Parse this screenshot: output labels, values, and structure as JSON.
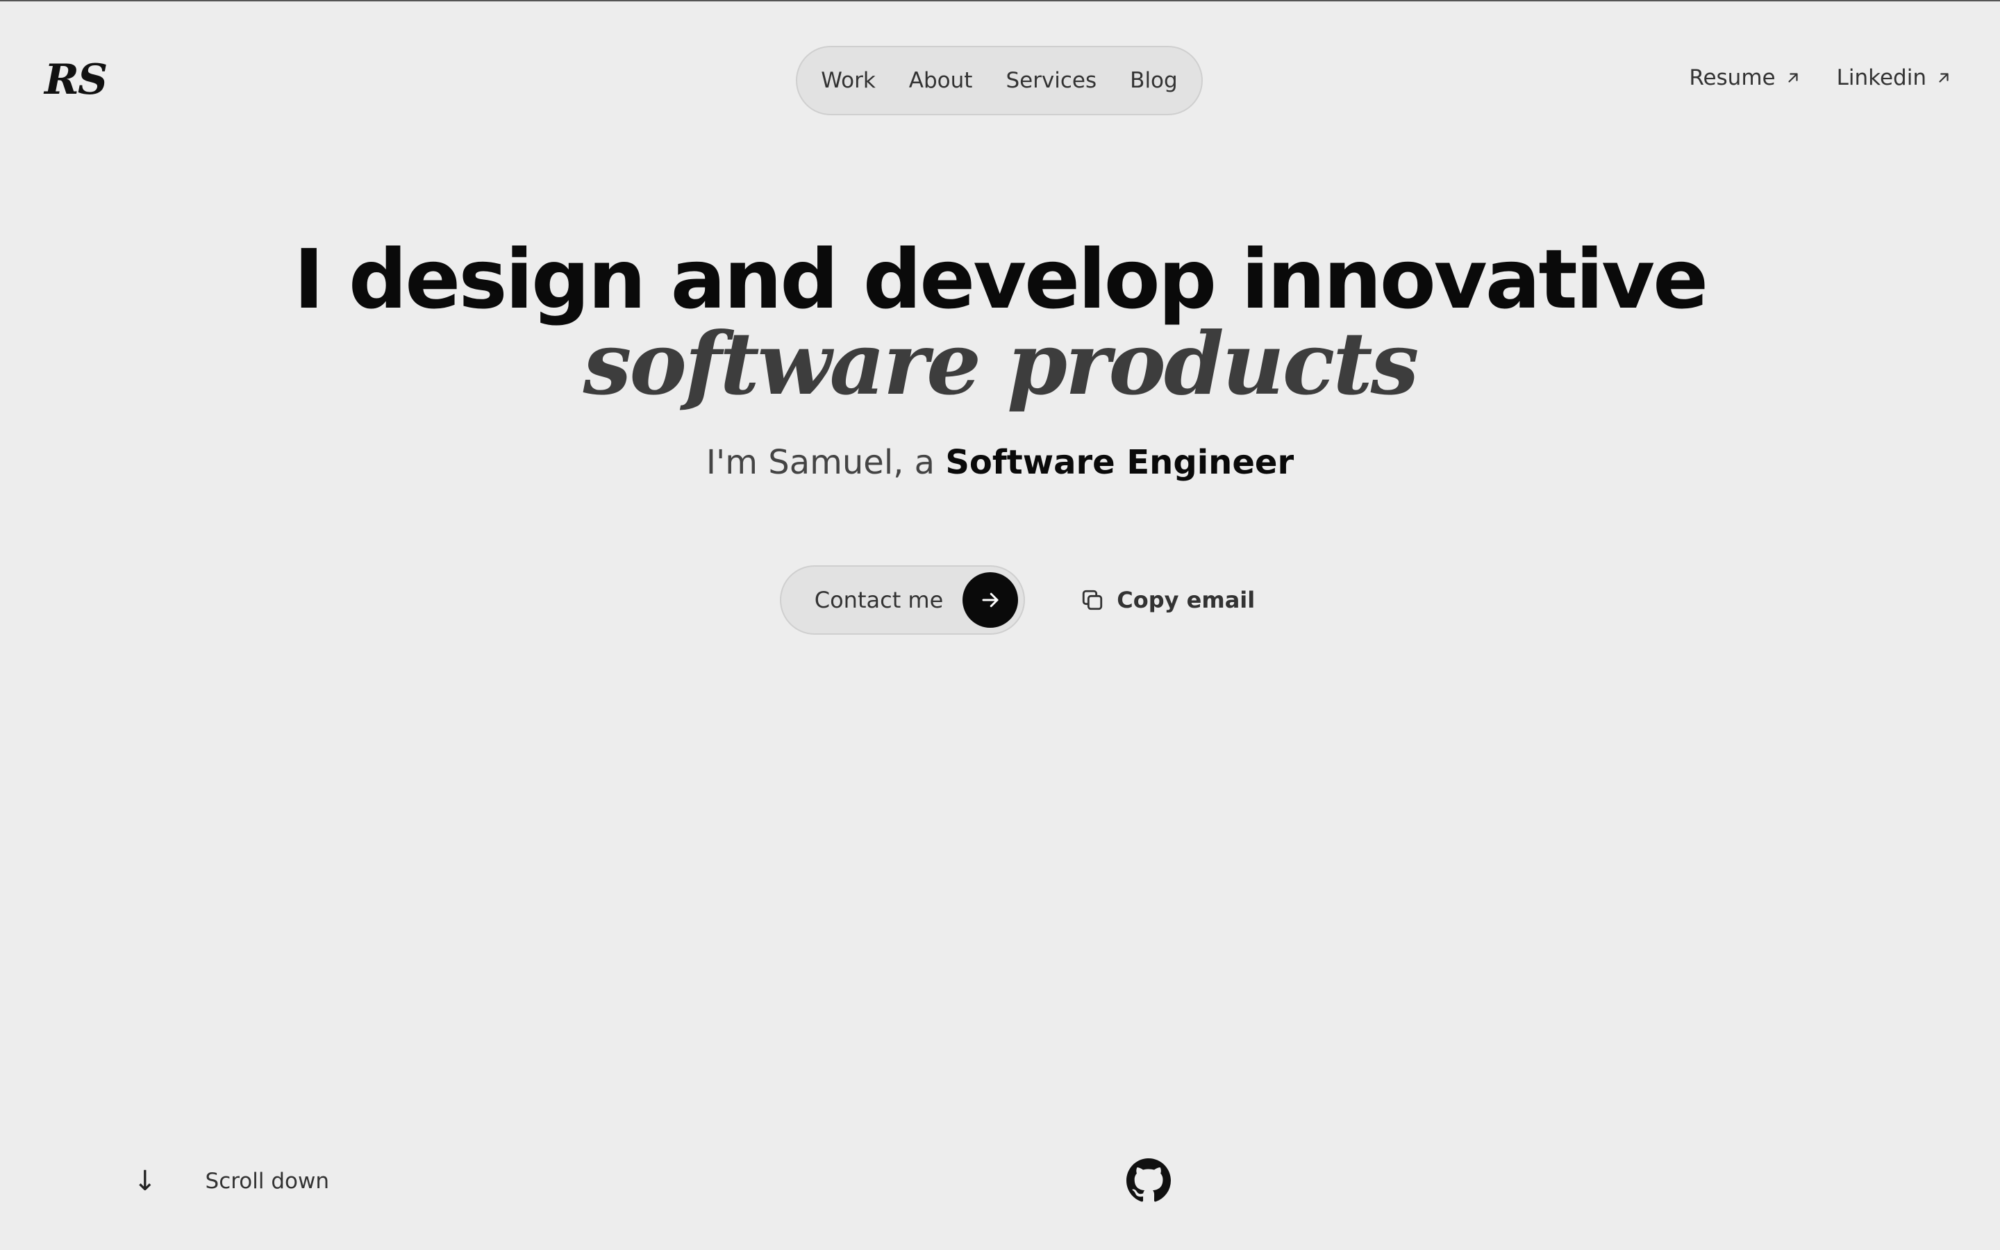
{
  "header": {
    "logo": "RS",
    "nav": [
      "Work",
      "About",
      "Services",
      "Blog"
    ],
    "links": [
      {
        "label": "Resume",
        "icon": "arrow-up-right-icon"
      },
      {
        "label": "Linkedin",
        "icon": "arrow-up-right-icon"
      }
    ]
  },
  "hero": {
    "title": "I design and develop innovative",
    "subtitle": "software products",
    "intro_prefix": "I'm Samuel, a ",
    "intro_role": "Software Engineer",
    "contact_label": "Contact me",
    "copy_email_label": "Copy email"
  },
  "footer": {
    "scroll_arrow": "↓",
    "scroll_label": "Scroll down",
    "github_icon": "github-icon"
  },
  "colors": {
    "background": "#ededed",
    "text": "#111111",
    "accent": "#0a0a0a",
    "pill": "#e2e2e2"
  }
}
